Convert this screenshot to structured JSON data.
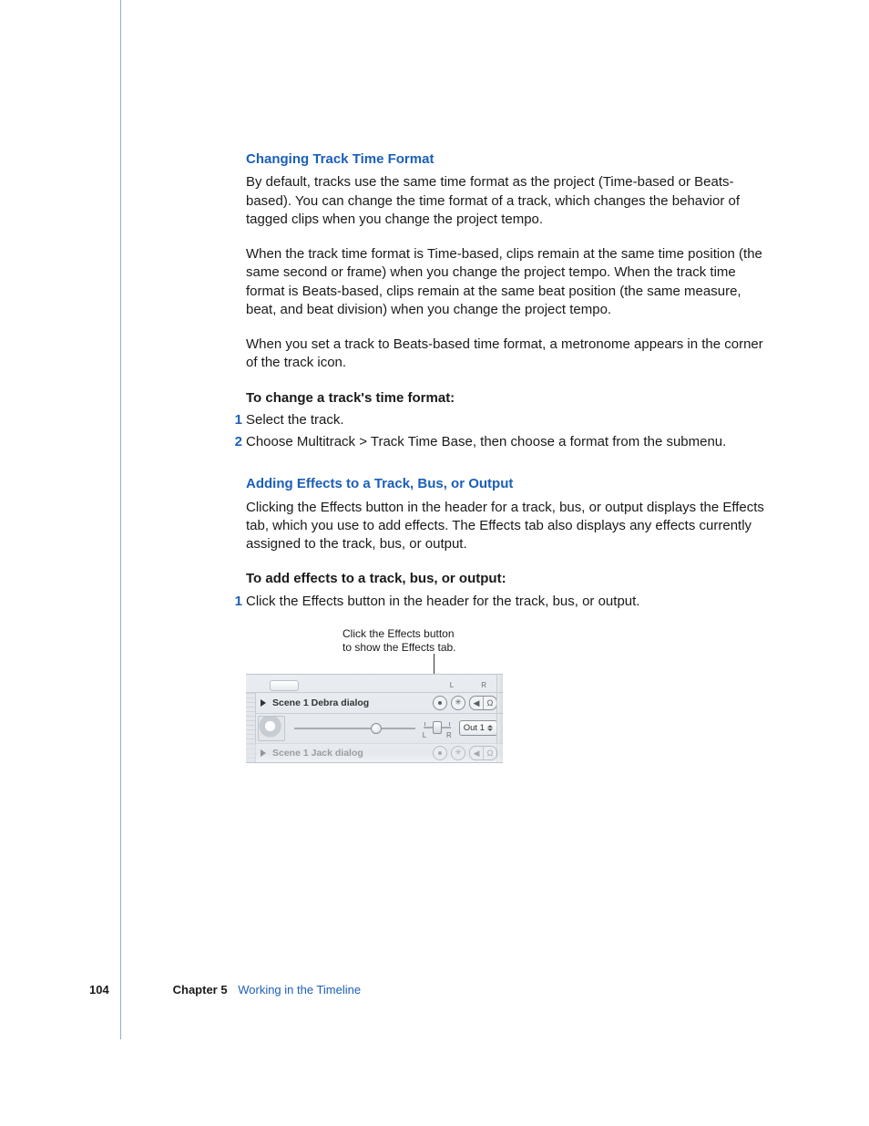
{
  "section1": {
    "heading": "Changing Track Time Format",
    "p1": "By default, tracks use the same time format as the project (Time-based or Beats-based). You can change the time format of a track, which changes the behavior of tagged clips when you change the project tempo.",
    "p2": "When the track time format is Time-based, clips remain at the same time position (the same second or frame) when you change the project tempo. When the track time format is Beats-based, clips remain at the same beat position (the same measure, beat, and beat division) when you change the project tempo.",
    "p3": "When you set a track to Beats-based time format, a metronome appears in the corner of the track icon.",
    "subhead": "To change a track's time format:",
    "steps": [
      "Select the track.",
      "Choose Multitrack > Track Time Base, then choose a format from the submenu."
    ]
  },
  "section2": {
    "heading": "Adding Effects to a Track, Bus, or Output",
    "p1": "Clicking the Effects button in the header for a track, bus, or output displays the Effects tab, which you use to add effects. The Effects tab also displays any effects currently assigned to the track, bus, or output.",
    "subhead": "To add effects to a track, bus, or output:",
    "steps": [
      "Click the Effects button in the header for the track, bus, or output."
    ]
  },
  "figure": {
    "caption_line1": "Click the Effects button",
    "caption_line2": "to show the Effects tab.",
    "toprow_L": "L",
    "toprow_R": "R",
    "track_name": "Scene 1 Debra dialog",
    "pan_L": "L",
    "pan_R": "R",
    "output_label": "Out 1",
    "faded_track_name": "Scene 1 Jack dialog"
  },
  "footer": {
    "page": "104",
    "chapter_label": "Chapter 5",
    "chapter_name": "Working in the Timeline"
  }
}
